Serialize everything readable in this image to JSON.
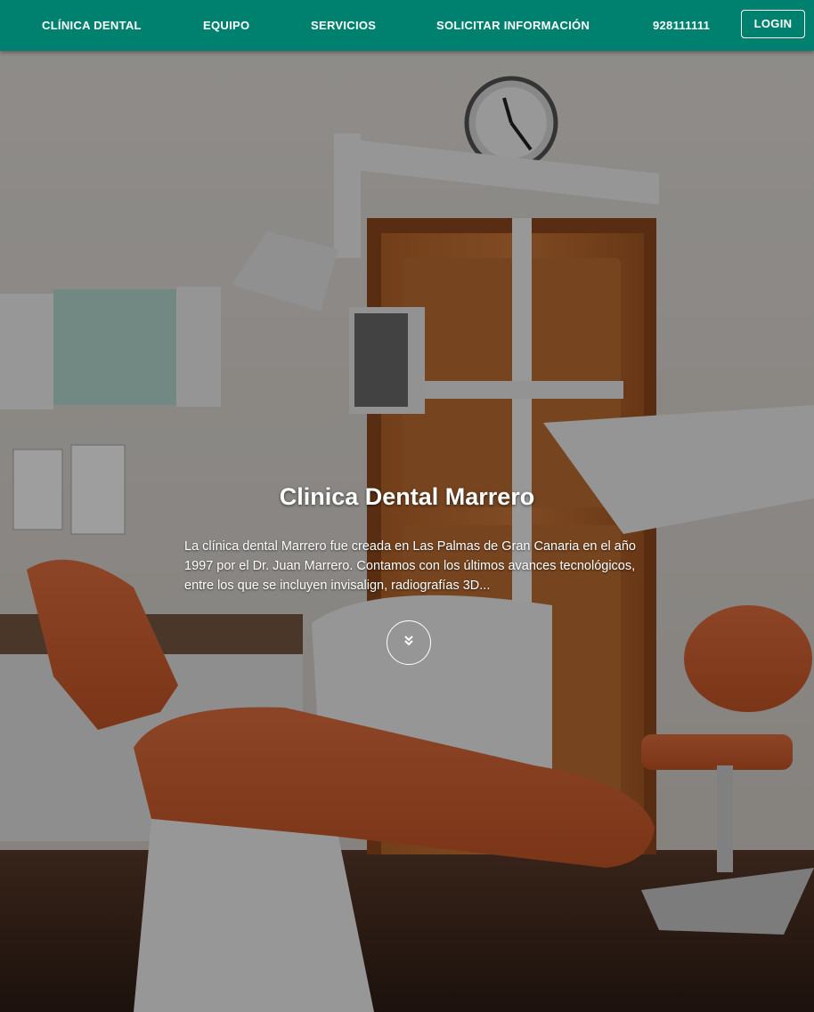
{
  "nav": {
    "brand": "CLÍNICA DENTAL",
    "equipo": "EQUIPO",
    "servicios": "SERVICIOS",
    "solicitar": "SOLICITAR INFORMACIÓN",
    "phone": "928111111",
    "login": "LOGIN"
  },
  "hero": {
    "title": "Clinica Dental Marrero",
    "description": "La clínica dental Marrero fue creada en Las Palmas de Gran Canaria en el año 1997 por el Dr. Juan Marrero. Contamos con los últimos avances tecnológicos, entre los que se incluyen invisalign, radiografías 3D...",
    "scroll_icon": "double-chevron-down-icon",
    "background_image": "dental-office-photo"
  },
  "colors": {
    "navbar": "#00806f",
    "text": "#ffffff",
    "chair": "#d4623a"
  }
}
